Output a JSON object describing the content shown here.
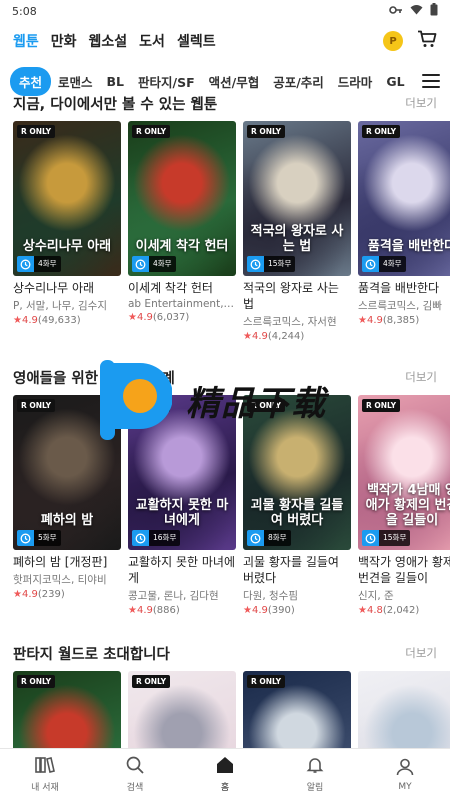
{
  "status": {
    "time": "5:08"
  },
  "top_nav": {
    "tabs": [
      {
        "label": "웹툰",
        "active": true
      },
      {
        "label": "만화",
        "active": false
      },
      {
        "label": "웹소설",
        "active": false
      },
      {
        "label": "도서",
        "active": false
      },
      {
        "label": "셀렉트",
        "active": false
      }
    ],
    "coin_label": "P"
  },
  "genres": {
    "tabs": [
      {
        "label": "추천",
        "active": true
      },
      {
        "label": "로맨스",
        "active": false
      },
      {
        "label": "BL",
        "active": false
      },
      {
        "label": "판타지/SF",
        "active": false
      },
      {
        "label": "액션/무협",
        "active": false
      },
      {
        "label": "공포/추리",
        "active": false
      },
      {
        "label": "드라마",
        "active": false
      },
      {
        "label": "GL",
        "active": false
      }
    ]
  },
  "sections": [
    {
      "title": "지금, 다이에서만 볼 수 있는 웹툰",
      "more": "더보기",
      "items": [
        {
          "title": "상수리나무 아래",
          "author": "P, 서말, 나무, 김수지",
          "rating": "4.9",
          "count": "(49,633)",
          "badge": "R ONLY",
          "free": "4화무",
          "cover_text": "상수리나무 아래",
          "colors": [
            "#3a2a1a",
            "#c79a3c",
            "#1f3b2a"
          ]
        },
        {
          "title": "이세계 착각 헌터",
          "author": "ab Entertainment, ...",
          "rating": "4.9",
          "count": "(6,037)",
          "badge": "R ONLY",
          "free": "4화무",
          "cover_text": "이세계 착각 헌터",
          "colors": [
            "#1a3d1a",
            "#c73a2a",
            "#2a6a3a"
          ]
        },
        {
          "title": "적국의 왕자로 사는 법",
          "author": "스르륵코믹스, 자서현",
          "rating": "4.9",
          "count": "(4,244)",
          "badge": "R ONLY",
          "free": "15화무",
          "cover_text": "적국의 왕자로 사는 법",
          "colors": [
            "#6a7a8a",
            "#d8d0c0",
            "#2a2a3a"
          ]
        },
        {
          "title": "품격을 배반한다",
          "author": "스르륵코믹스, 김빠",
          "rating": "4.9",
          "count": "(8,385)",
          "badge": "R ONLY",
          "free": "4화무",
          "cover_text": "품격을 배반한다",
          "colors": [
            "#6a6aa0",
            "#dcd8ec",
            "#3a3a6a"
          ]
        }
      ]
    },
    {
      "title": "영애들을 위한 판타지 세계",
      "more": "더보기",
      "items": [
        {
          "title": "폐하의 밤 [개정판]",
          "author": "핫퍼지코믹스, 티야비",
          "rating": "4.9",
          "count": "(239)",
          "badge": "R ONLY",
          "free": "5화무",
          "cover_text": "폐하의 밤",
          "colors": [
            "#1a1a1a",
            "#6a5a4a",
            "#2a2222"
          ]
        },
        {
          "title": "교활하지 못한 마녀에게",
          "author": "콩고물, 론나, 김다현",
          "rating": "4.9",
          "count": "(886)",
          "badge": "R ONLY",
          "free": "16화무",
          "cover_text": "교활하지 못한 마녀에게",
          "colors": [
            "#5a3a8a",
            "#b89ad8",
            "#2a1a4a"
          ]
        },
        {
          "title": "괴물 황자를 길들여 버렸다",
          "author": "다원, 청수핌",
          "rating": "4.9",
          "count": "(390)",
          "badge": "R ONLY",
          "free": "8화무",
          "cover_text": "괴물 황자를 길들여 버렸다",
          "colors": [
            "#2a4a3a",
            "#c8b070",
            "#1a2a2a"
          ]
        },
        {
          "title": "백작가 영애가 황제의 번견을 길들이",
          "author": "신지, 준",
          "rating": "4.8",
          "count": "(2,042)",
          "badge": "R ONLY",
          "free": "15화무",
          "cover_text": "백작가 4남매 영애가 황제의 번견을 길들이",
          "colors": [
            "#e8a0b0",
            "#fbe0e8",
            "#b86a8a"
          ]
        }
      ]
    },
    {
      "title": "판타지 월드로 초대합니다",
      "more": "더보기",
      "items": [
        {
          "badge": "R ONLY",
          "colors": [
            "#1a3d1a",
            "#c73a2a",
            "#2a6a3a"
          ]
        },
        {
          "badge": "R ONLY",
          "colors": [
            "#f0e8ec",
            "#a0a0b0",
            "#e8d8e0"
          ]
        },
        {
          "badge": "R ONLY",
          "colors": [
            "#1a2a4a",
            "#d0d8e0",
            "#3a4a6a"
          ]
        },
        {
          "badge": "",
          "colors": [
            "#f0f0f4",
            "#b8c8d8",
            "#e0e0e8"
          ]
        }
      ]
    }
  ],
  "watermark": {
    "text": "精品下载"
  },
  "bottom_nav": {
    "items": [
      {
        "label": "내 서재",
        "icon": "library-icon",
        "active": false
      },
      {
        "label": "검색",
        "icon": "search-icon",
        "active": false
      },
      {
        "label": "홈",
        "icon": "home-icon",
        "active": true
      },
      {
        "label": "알림",
        "icon": "bell-icon",
        "active": false
      },
      {
        "label": "MY",
        "icon": "user-icon",
        "active": false
      }
    ]
  },
  "accent": "#1b9bf0"
}
